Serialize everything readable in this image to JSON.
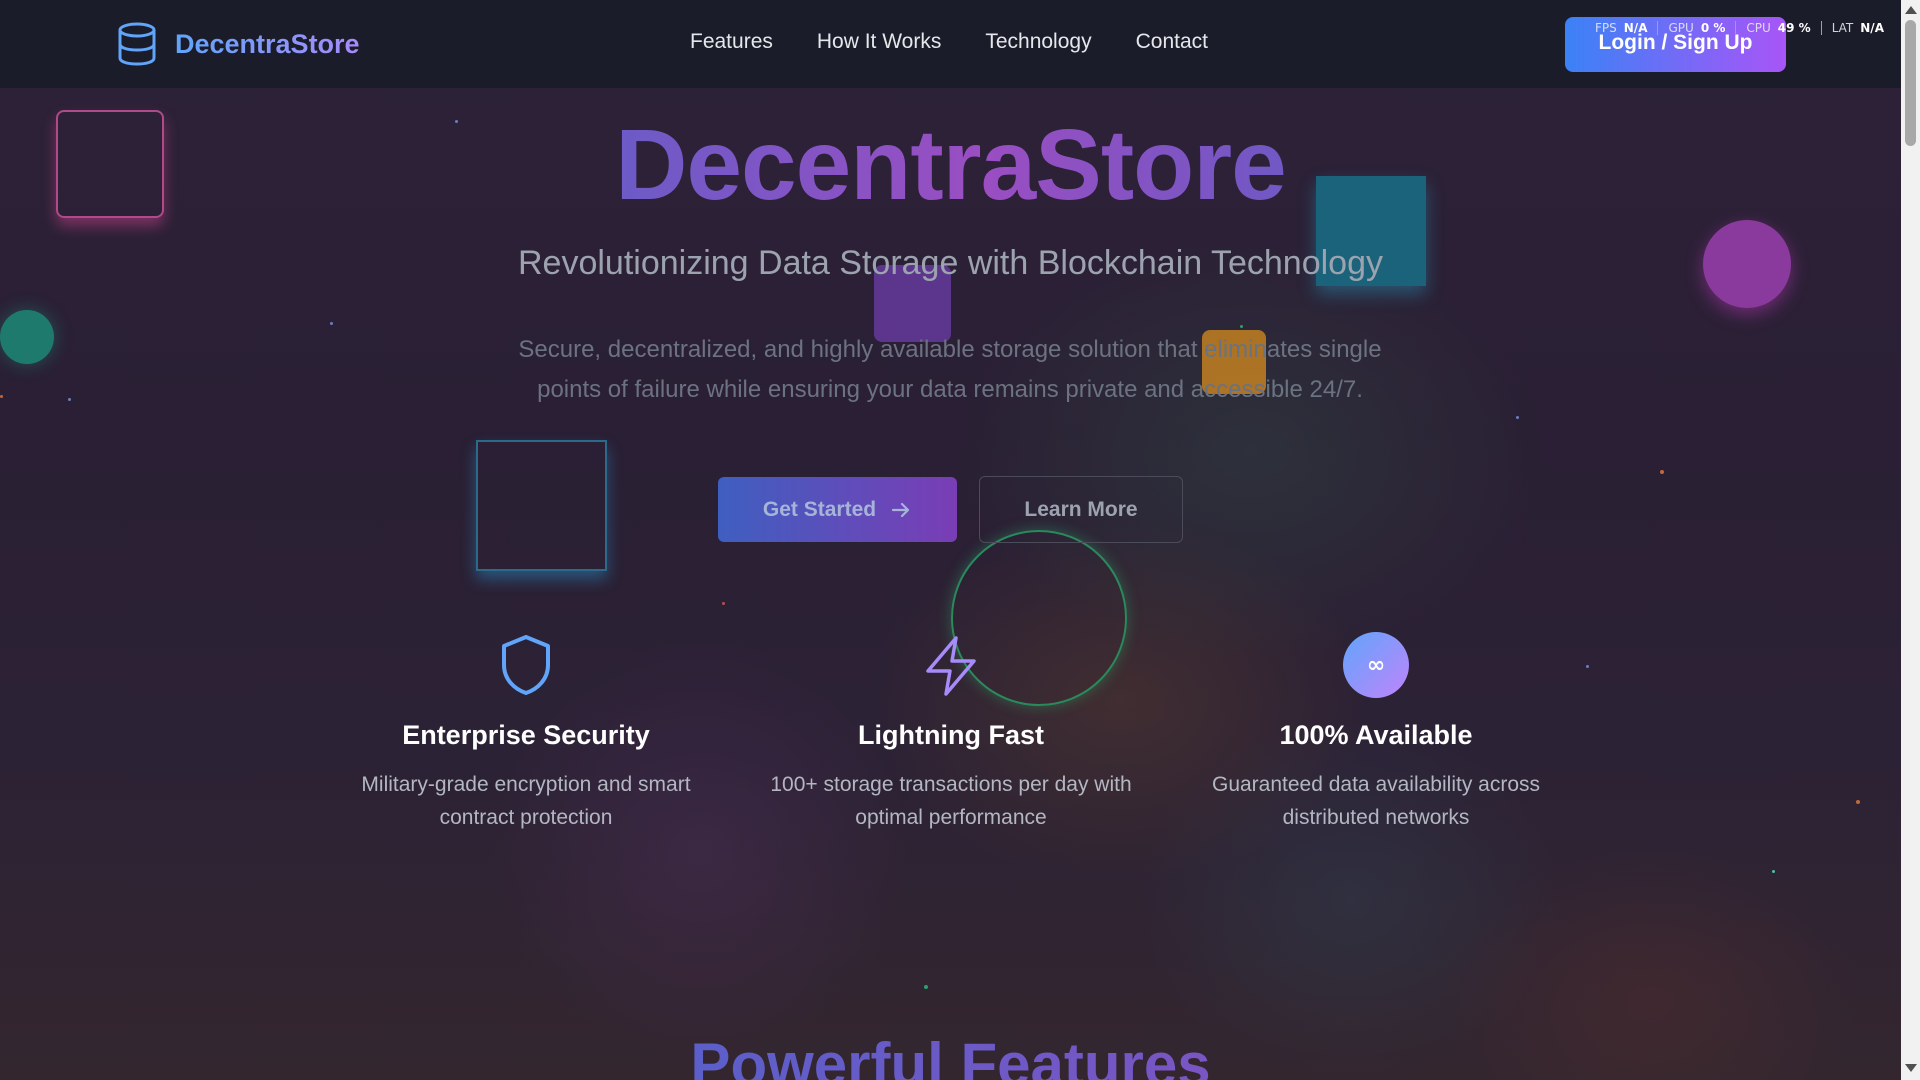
{
  "navbar": {
    "brand": "DecentraStore",
    "links": [
      "Features",
      "How It Works",
      "Technology",
      "Contact"
    ],
    "login_label": "Login / Sign Up"
  },
  "perf": {
    "fps_label": "FPS",
    "fps_value": "N/A",
    "gpu_label": "GPU",
    "gpu_value": "0 %",
    "cpu_label": "CPU",
    "cpu_value": "49 %",
    "lat_label": "LAT",
    "lat_value": "N/A"
  },
  "hero": {
    "title": "DecentraStore",
    "subtitle": "Revolutionizing Data Storage with Blockchain Technology",
    "description": "Secure, decentralized, and highly available storage solution that eliminates single points of failure while ensuring your data remains private and accessible 24/7.",
    "get_started": "Get Started",
    "learn_more": "Learn More"
  },
  "features": [
    {
      "icon": "shield-icon",
      "title": "Enterprise Security",
      "desc": "Military-grade encryption and smart contract protection"
    },
    {
      "icon": "lightning-icon",
      "title": "Lightning Fast",
      "desc": "100+ storage transactions per day with optimal performance"
    },
    {
      "icon": "infinity-icon",
      "title": "100% Available",
      "desc": "Guaranteed data availability across distributed networks",
      "badge": "∞"
    }
  ],
  "next_section_title": "Powerful Features",
  "colors": {
    "accent_blue": "#3b82f6",
    "accent_purple": "#a855f7",
    "navbar_bg": "#1a1c2a"
  }
}
